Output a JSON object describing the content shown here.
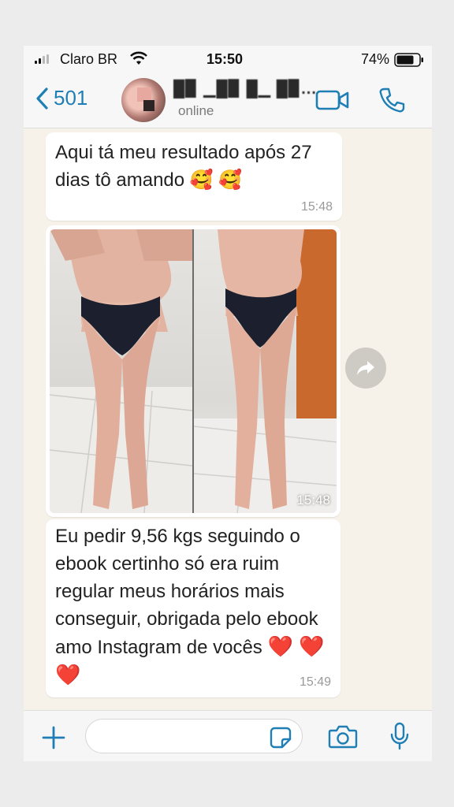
{
  "status_bar": {
    "carrier": "Claro BR",
    "time": "15:50",
    "battery_percent": "74%",
    "signal_bars": 2
  },
  "header": {
    "back_count": "501",
    "contact_name": "█▉ ▁█▉ █▁ █▉...",
    "contact_status": "online",
    "accent_color": "#1f7fb5"
  },
  "messages": [
    {
      "type": "text",
      "text": "Aqui tá meu resultado após 27 dias tô amando",
      "emoji": "🥰 🥰",
      "time": "15:48"
    },
    {
      "type": "image",
      "description_icon": "before-after-photo",
      "time": "15:48"
    },
    {
      "type": "text",
      "text": "Eu pedir 9,56 kgs seguindo o ebook certinho só era ruim regular meus horários mais conseguir, obrigada pelo ebook amo Instagram de vocês",
      "hearts": "❤️ ❤️ ❤️",
      "time": "15:49"
    }
  ],
  "composer": {
    "input_value": "",
    "icons": [
      "plus-icon",
      "sticker-icon",
      "camera-icon",
      "microphone-icon"
    ]
  },
  "colors": {
    "bubble": "#ffffff",
    "chat_background": "#f6f2ea",
    "heart": "#e0142c"
  }
}
